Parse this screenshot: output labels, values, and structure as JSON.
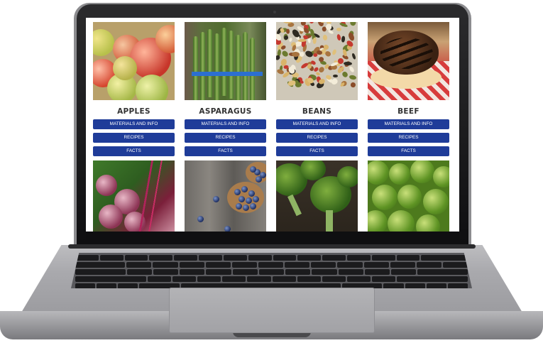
{
  "products": [
    {
      "name": "APPLES",
      "buttons": [
        "MATERIALS AND INFO",
        "RECIPES",
        "FACTS"
      ],
      "photo_icon": "apples-photo"
    },
    {
      "name": "ASPARAGUS",
      "buttons": [
        "MATERIALS AND INFO",
        "RECIPES",
        "FACTS"
      ],
      "photo_icon": "asparagus-photo"
    },
    {
      "name": "BEANS",
      "buttons": [
        "MATERIALS AND INFO",
        "RECIPES",
        "FACTS"
      ],
      "photo_icon": "beans-photo"
    },
    {
      "name": "BEEF",
      "buttons": [
        "MATERIALS AND INFO",
        "RECIPES",
        "FACTS"
      ],
      "photo_icon": "beef-photo"
    }
  ],
  "second_row_photos": [
    "beets-photo",
    "blueberries-photo",
    "broccoli-photo",
    "brussels-sprouts-photo"
  ],
  "colors": {
    "button": "#1f3c99",
    "title": "#333333",
    "page_bg": "#ffffff"
  }
}
